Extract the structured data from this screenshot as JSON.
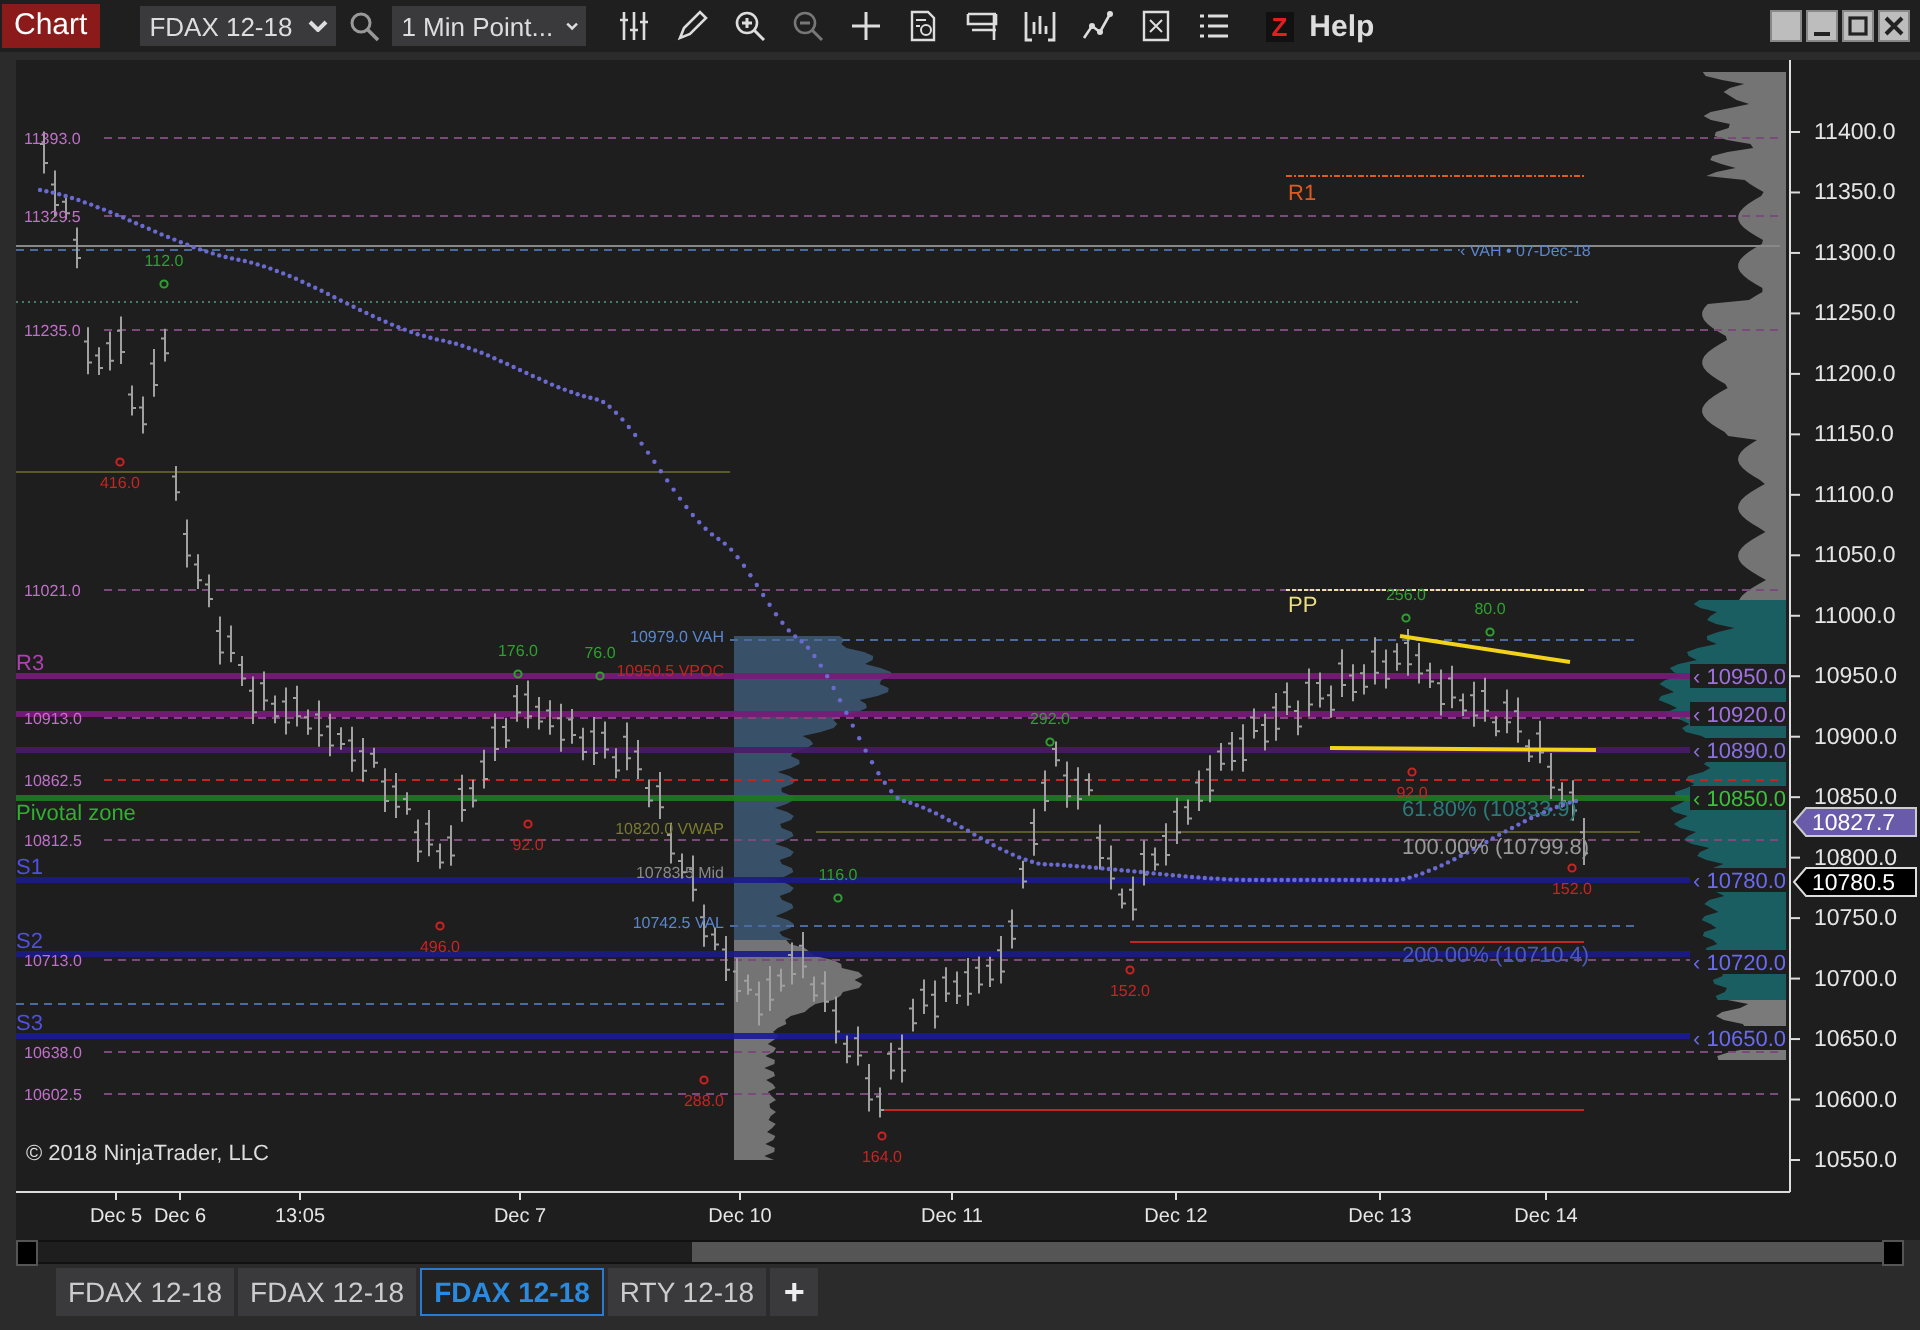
{
  "toolbar": {
    "title": "Chart",
    "instrument": "FDAX 12-18",
    "interval": "1 Min Point...",
    "help_badge": "Z",
    "help": "Help"
  },
  "chart": {
    "price_labels": [
      "11393.0",
      "11329.5",
      "11235.0",
      "11021.0",
      "10913.0",
      "10862.5",
      "10812.5",
      "10713.0",
      "10638.0",
      "10602.5"
    ],
    "zone_labels": [
      {
        "text": "R3",
        "color": "#b040b0"
      },
      {
        "text": "Pivotal zone",
        "color": "#30b030"
      },
      {
        "text": "S1",
        "color": "#5050e0"
      },
      {
        "text": "S2",
        "color": "#5050e0"
      },
      {
        "text": "S3",
        "color": "#5050e0"
      }
    ],
    "profile_labels": [
      {
        "text": "10979.0 VAH",
        "color": "#5a86d0"
      },
      {
        "text": "10950.5 VPOC",
        "color": "#c42222"
      },
      {
        "text": "10820.0 VWAP",
        "color": "#7a7a30"
      },
      {
        "text": "10783.5 Mid",
        "color": "#8a8a8a"
      },
      {
        "text": "10742.5 VAL",
        "color": "#5a86d0"
      }
    ],
    "level_tags": [
      {
        "text": "‹ 10950.0",
        "color": "#a070e0"
      },
      {
        "text": "‹ 10920.0",
        "color": "#a070e0"
      },
      {
        "text": "‹ 10890.0",
        "color": "#8a70e0"
      },
      {
        "text": "‹ 10850.0",
        "color": "#3cc03c"
      },
      {
        "text": "‹ 10780.0",
        "color": "#6a6af0"
      },
      {
        "text": "‹ 10720.0",
        "color": "#6a6af0"
      },
      {
        "text": "‹ 10650.0",
        "color": "#6a6af0"
      }
    ],
    "session_tag": "‹ VAH • 07-Dec-18",
    "pivot_labels": [
      "R1",
      "PP"
    ],
    "fib_labels": [
      "61.80% (10833.9)",
      "100.00% (10799.8)",
      "200.00% (10710.4)"
    ],
    "swing_labels": [
      {
        "text": "112.0",
        "color": "#2ea02e"
      },
      {
        "text": "416.0",
        "color": "#cc2222"
      },
      {
        "text": "176.0",
        "color": "#2ea02e"
      },
      {
        "text": "76.0",
        "color": "#2ea02e"
      },
      {
        "text": "92.0",
        "color": "#cc2222"
      },
      {
        "text": "496.0",
        "color": "#cc2222"
      },
      {
        "text": "116.0",
        "color": "#2ea02e"
      },
      {
        "text": "292.0",
        "color": "#2ea02e"
      },
      {
        "text": "288.0",
        "color": "#cc2222"
      },
      {
        "text": "164.0",
        "color": "#cc2222"
      },
      {
        "text": "152.0",
        "color": "#cc2222"
      },
      {
        "text": "256.0",
        "color": "#2ea02e"
      },
      {
        "text": "80.0",
        "color": "#2ea02e"
      },
      {
        "text": "92.0",
        "color": "#cc2222"
      },
      {
        "text": "152.0",
        "color": "#cc2222"
      }
    ],
    "copyright": "© 2018 NinjaTrader, LLC",
    "price_axis": [
      "11400.0",
      "11350.0",
      "11300.0",
      "11250.0",
      "11200.0",
      "11150.0",
      "11100.0",
      "11050.0",
      "11000.0",
      "10950.0",
      "10900.0",
      "10850.0",
      "10800.0",
      "10750.0",
      "10700.0",
      "10650.0",
      "10600.0",
      "10550.0"
    ],
    "last_price": "10827.7",
    "marker_price": "10780.5",
    "time_axis": [
      "Dec 5",
      "Dec 6",
      "13:05",
      "Dec 7",
      "Dec 10",
      "Dec 11",
      "Dec 12",
      "Dec 13",
      "Dec 14"
    ]
  },
  "tabs": [
    {
      "label": "FDAX 12-18",
      "selected": false
    },
    {
      "label": "FDAX 12-18",
      "selected": false
    },
    {
      "label": "FDAX 12-18",
      "selected": true
    },
    {
      "label": "RTY 12-18",
      "selected": false
    }
  ],
  "add_tab": "+"
}
